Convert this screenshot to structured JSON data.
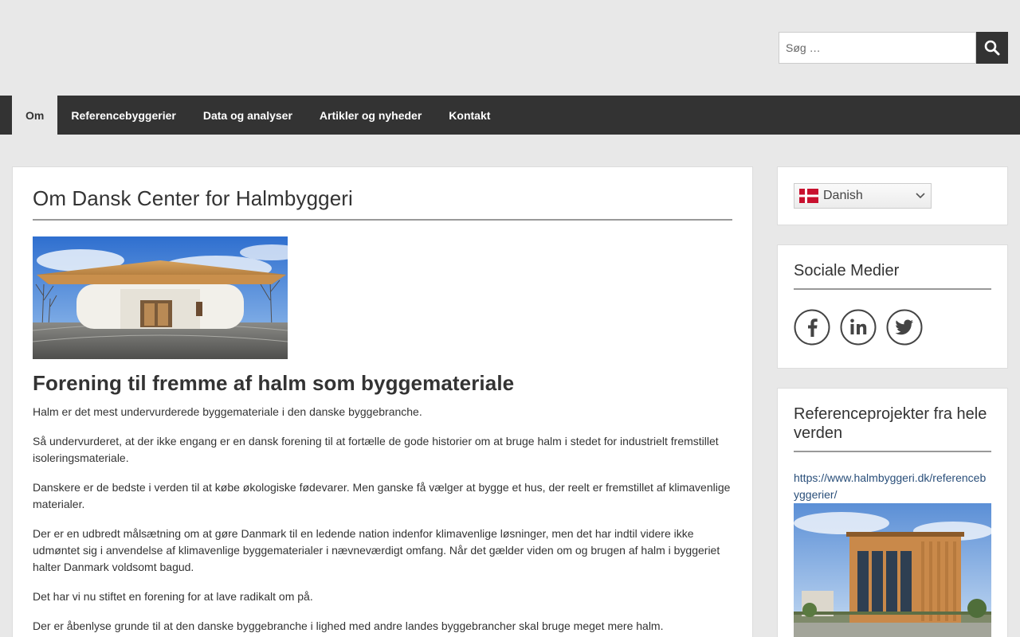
{
  "search": {
    "placeholder": "Søg …"
  },
  "nav": {
    "items": [
      {
        "label": "Om"
      },
      {
        "label": "Referencebyggerier"
      },
      {
        "label": "Data og analyser"
      },
      {
        "label": "Artikler og nyheder"
      },
      {
        "label": "Kontakt"
      }
    ]
  },
  "main": {
    "title": "Om Dansk Center for Halmbyggeri",
    "subtitle": "Forening til fremme af halm som byggemateriale",
    "paragraphs": [
      "Halm er det mest undervurderede byggemateriale i den danske byggebranche.",
      "Så undervurderet, at der ikke engang er en dansk forening til at fortælle de gode historier om at bruge halm i stedet for industrielt fremstillet isoleringsmateriale.",
      "Danskere er de bedste i verden til at købe økologiske fødevarer. Men ganske få vælger at bygge et hus, der reelt er fremstillet af klimavenlige materialer.",
      "Der er en udbredt målsætning om at gøre Danmark til en ledende nation indenfor klimavenlige løsninger, men det har indtil videre ikke udmøntet sig i anvendelse af klimavenlige byggematerialer i nævneværdigt omfang. Når det gælder viden om og brugen af halm i byggeriet halter Danmark voldsomt bagud.",
      "Det har vi nu stiftet en forening for at lave radikalt om på.",
      "Der er åbenlyse grunde til at den danske byggebranche i lighed med andre landes byggebrancher skal bruge meget mere halm."
    ]
  },
  "sidebar": {
    "language": {
      "selected": "Danish"
    },
    "social": {
      "title": "Sociale Medier",
      "icons": [
        "facebook-icon",
        "linkedin-icon",
        "twitter-icon"
      ]
    },
    "reference": {
      "title": "Referenceprojekter fra hele verden",
      "link": "https://www.halmbyggeri.dk/referencebyggerier/"
    }
  },
  "colors": {
    "nav_bg": "#333333",
    "page_bg": "#e8e8e8",
    "link": "#2a4f7a"
  }
}
